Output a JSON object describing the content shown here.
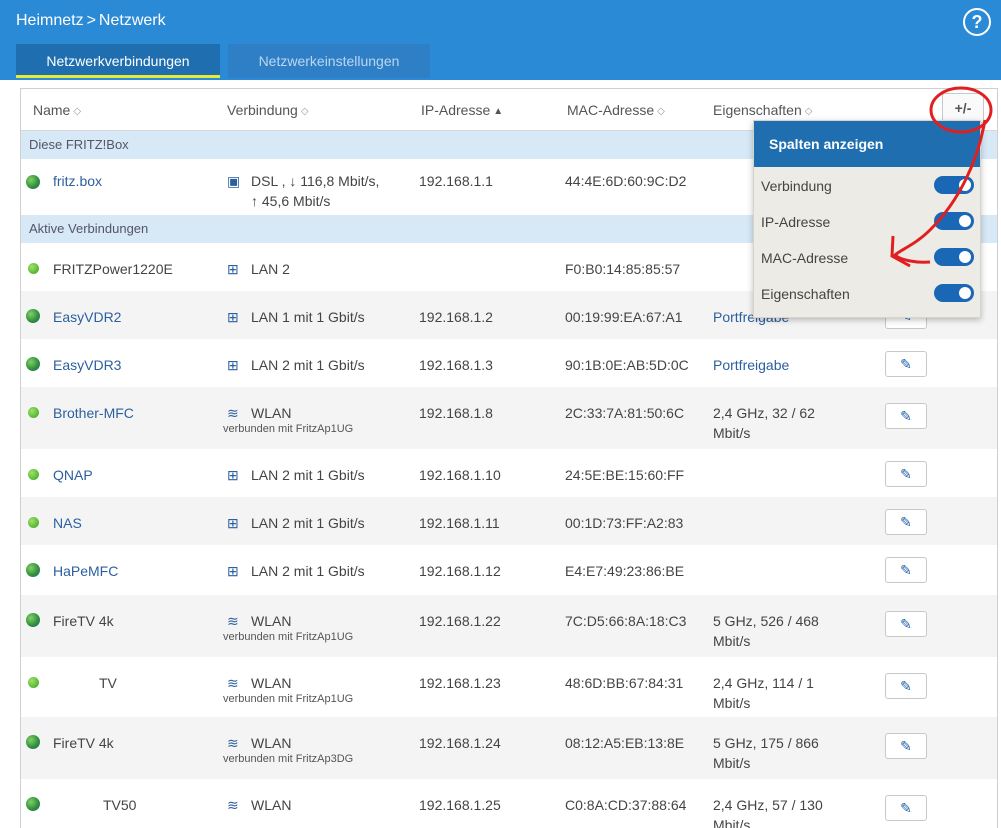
{
  "header": {
    "breadcrumb": [
      "Heimnetz",
      "Netzwerk"
    ],
    "breadcrumb_sep": ">",
    "help_label": "?"
  },
  "tabs": [
    {
      "label": "Netzwerkverbindungen",
      "active": true
    },
    {
      "label": "Netzwerkeinstellungen",
      "active": false
    }
  ],
  "table": {
    "columns": [
      "Name",
      "Verbindung",
      "IP-Adresse",
      "MAC-Adresse",
      "Eigenschaften"
    ],
    "add_column_label": "+/-",
    "groups": [
      "Diese FRITZ!Box",
      "Aktive Verbindungen"
    ],
    "rows": [
      {
        "name": "fritz.box",
        "icon": "router-globe-icon",
        "connection": "DSL , ↓ 116,8 Mbit/s,",
        "connection_2": "↑ 45,6 Mbit/s",
        "conn_icon": "dsl-icon",
        "ip": "192.168.1.1",
        "mac": "44:4E:6D:60:9C:D2",
        "props": ""
      },
      {
        "name": "FRITZPower1220E",
        "icon": "status-dot-icon",
        "connection": "LAN 2",
        "conn_icon": "lan-icon",
        "ip": "",
        "mac": "F0:B0:14:85:85:57",
        "props": ""
      },
      {
        "name": "EasyVDR2",
        "icon": "globe-icon",
        "connection": "LAN 1 mit 1 Gbit/s",
        "conn_icon": "lan-icon",
        "ip": "192.168.1.2",
        "mac": "00:19:99:EA:67:A1",
        "props": "Portfreigabe"
      },
      {
        "name": "EasyVDR3",
        "icon": "globe-icon",
        "connection": "LAN 2 mit 1 Gbit/s",
        "conn_icon": "lan-icon",
        "ip": "192.168.1.3",
        "mac": "90:1B:0E:AB:5D:0C",
        "props": "Portfreigabe"
      },
      {
        "name": "Brother-MFC",
        "icon": "status-dot-icon",
        "connection": "WLAN",
        "sub": "verbunden mit FritzAp1UG",
        "conn_icon": "wlan-icon",
        "ip": "192.168.1.8",
        "mac": "2C:33:7A:81:50:6C",
        "props": "2,4 GHz, 32 / 62 Mbit/s"
      },
      {
        "name": "QNAP",
        "icon": "status-dot-icon",
        "connection": "LAN 2 mit 1 Gbit/s",
        "conn_icon": "lan-icon",
        "ip": "192.168.1.10",
        "mac": "24:5E:BE:15:60:FF",
        "props": ""
      },
      {
        "name": "NAS",
        "icon": "status-dot-icon",
        "connection": "LAN 2 mit 1 Gbit/s",
        "conn_icon": "lan-icon",
        "ip": "192.168.1.11",
        "mac": "00:1D:73:FF:A2:83",
        "props": ""
      },
      {
        "name": "HaPeMFC",
        "icon": "globe-icon",
        "connection": "LAN 2 mit 1 Gbit/s",
        "conn_icon": "lan-icon",
        "ip": "192.168.1.12",
        "mac": "E4:E7:49:23:86:BE",
        "props": ""
      },
      {
        "name": "FireTV 4k",
        "icon": "globe-icon",
        "connection": "WLAN",
        "sub": "verbunden mit FritzAp1UG",
        "conn_icon": "wlan-icon",
        "ip": "192.168.1.22",
        "mac": "7C:D5:66:8A:18:C3",
        "props": "5 GHz, 526 / 468 Mbit/s"
      },
      {
        "name": "TV",
        "icon": "status-dot-icon",
        "connection": "WLAN",
        "sub": "verbunden mit FritzAp1UG",
        "conn_icon": "wlan-icon",
        "ip": "192.168.1.23",
        "mac": "48:6D:BB:67:84:31",
        "props": "2,4 GHz, 114 / 1 Mbit/s"
      },
      {
        "name": "FireTV 4k",
        "icon": "globe-icon",
        "connection": "WLAN",
        "sub": "verbunden mit FritzAp3DG",
        "conn_icon": "wlan-icon",
        "ip": "192.168.1.24",
        "mac": "08:12:A5:EB:13:8E",
        "props": "5 GHz, 175 / 866 Mbit/s"
      },
      {
        "name": "TV50",
        "icon": "globe-icon",
        "connection": "WLAN",
        "conn_icon": "wlan-icon",
        "ip": "192.168.1.25",
        "mac": "C0:8A:CD:37:88:64",
        "props": "2,4 GHz, 57 / 130 Mbit/s"
      }
    ]
  },
  "popup": {
    "title": "Spalten anzeigen",
    "options": [
      {
        "label": "Verbindung",
        "on": true
      },
      {
        "label": "IP-Adresse",
        "on": true
      },
      {
        "label": "MAC-Adresse",
        "on": true
      },
      {
        "label": "Eigenschaften",
        "on": true
      }
    ]
  },
  "colors": {
    "accent": "#2a8ad6",
    "tab_active": "#1f6fb0",
    "annotation": "#e02020"
  }
}
